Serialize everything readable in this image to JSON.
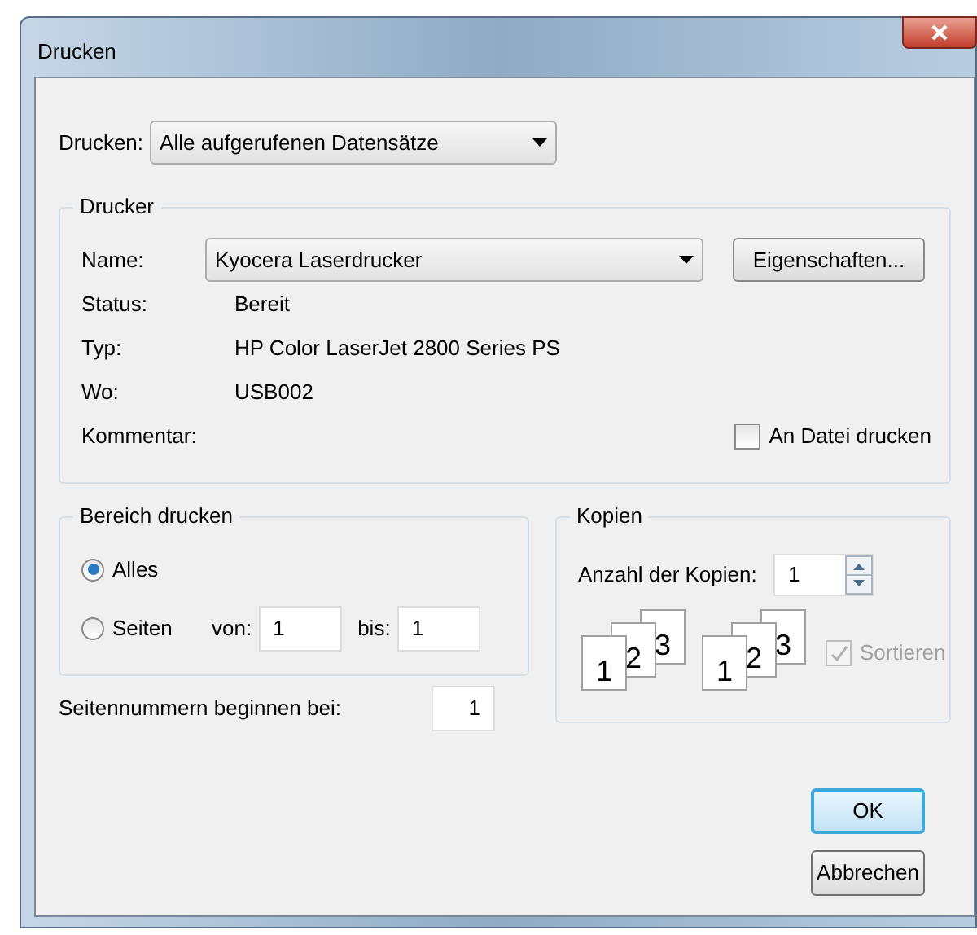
{
  "window": {
    "title": "Drucken"
  },
  "print_what": {
    "label": "Drucken:",
    "value": "Alle aufgerufenen Datensätze"
  },
  "printer": {
    "title": "Drucker",
    "name_label": "Name:",
    "name_value": "Kyocera Laserdrucker",
    "properties_button": "Eigenschaften...",
    "info": [
      {
        "label": "Status:",
        "value": "Bereit"
      },
      {
        "label": "Typ:",
        "value": "HP Color LaserJet 2800 Series PS"
      },
      {
        "label": "Wo:",
        "value": "USB002"
      },
      {
        "label": "Kommentar:"
      }
    ],
    "print_to_file": {
      "label": "An Datei drucken",
      "checked": false
    }
  },
  "range": {
    "title": "Bereich drucken",
    "options": [
      {
        "label": "Alles",
        "selected": true
      },
      {
        "label": "Seiten",
        "selected": false
      }
    ],
    "from_label": "von:",
    "from_value": "1",
    "to_label": "bis:",
    "to_value": "1"
  },
  "start_page": {
    "label": "Seitennummern beginnen bei:",
    "value": "1"
  },
  "copies": {
    "title": "Kopien",
    "count_label": "Anzahl der Kopien:",
    "count_value": "1",
    "collate_icons": [
      [
        "1",
        "2",
        "3"
      ],
      [
        "1",
        "2",
        "3"
      ]
    ],
    "collate": {
      "label": "Sortieren",
      "checked": true,
      "disabled": true
    }
  },
  "buttons": [
    {
      "label": "OK",
      "default": true
    },
    {
      "label": "Abbrechen",
      "default": false
    }
  ]
}
